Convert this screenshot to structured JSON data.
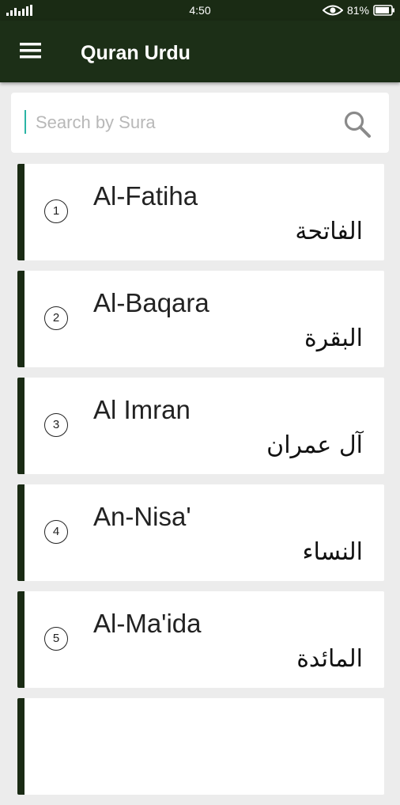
{
  "status_bar": {
    "time": "4:50",
    "battery": "81%",
    "icons": [
      "signal-icon",
      "eye-icon",
      "battery-icon"
    ]
  },
  "app_bar": {
    "title": "Quran Urdu",
    "menu_icon": "menu-icon"
  },
  "search": {
    "placeholder": "Search by Sura",
    "value": "",
    "icon": "search-icon"
  },
  "suras": [
    {
      "number": "1",
      "name": "Al-Fatiha",
      "arabic": "الفاتحة"
    },
    {
      "number": "2",
      "name": "Al-Baqara",
      "arabic": "البقرة"
    },
    {
      "number": "3",
      "name": "Al Imran",
      "arabic": "آل عمران"
    },
    {
      "number": "4",
      "name": "An-Nisa'",
      "arabic": "النساء"
    },
    {
      "number": "5",
      "name": "Al-Ma'ida",
      "arabic": "المائدة"
    }
  ],
  "colors": {
    "app_bar": "#1c2f17",
    "accent_bar": "#1a2b14",
    "background": "#ececec",
    "caret": "#2bb5a5"
  }
}
